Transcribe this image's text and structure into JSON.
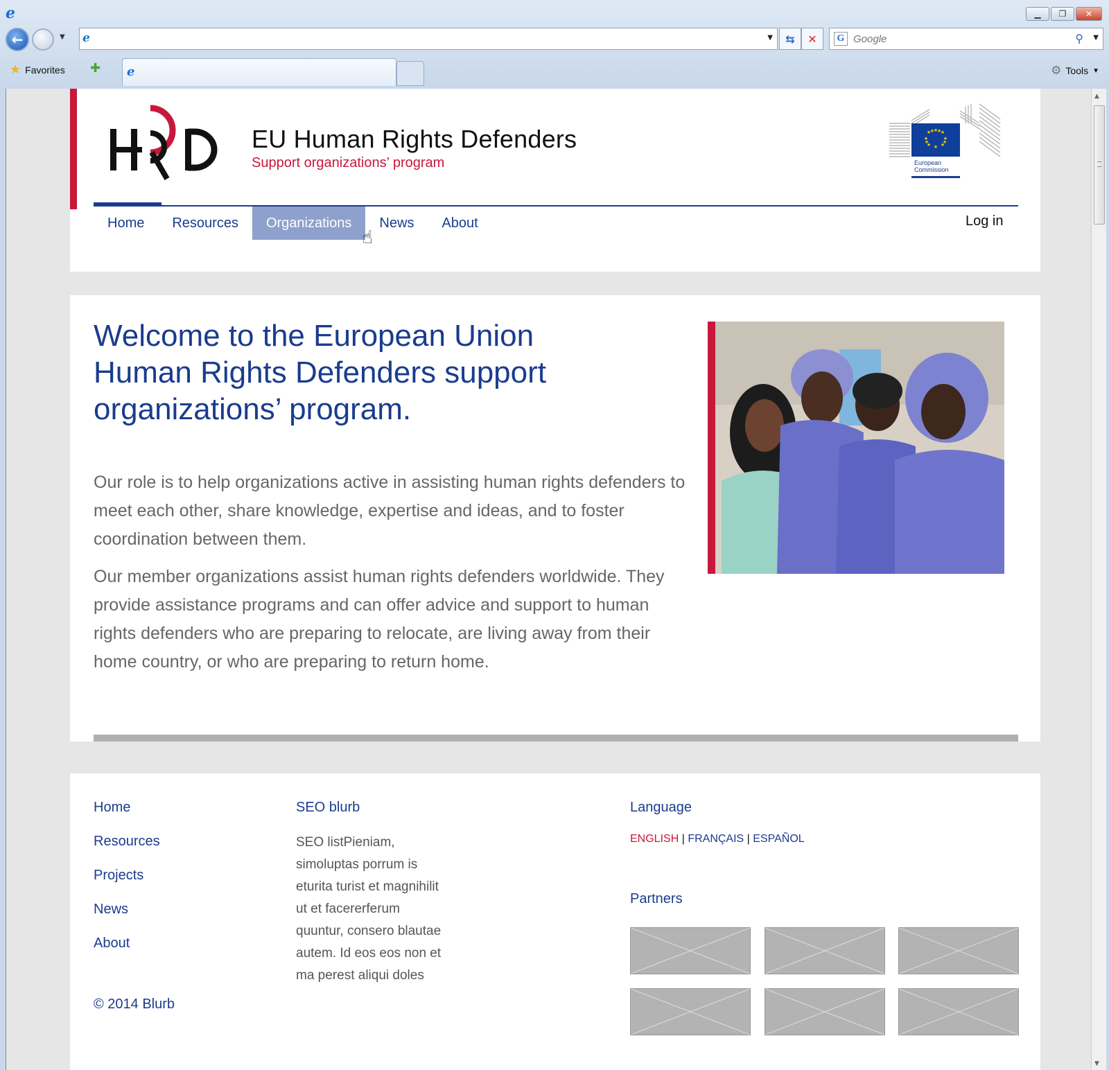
{
  "browser": {
    "search_placeholder": "Google",
    "favorites_label": "Favorites",
    "tools_label": "Tools"
  },
  "site": {
    "title": "EU Human Rights Defenders",
    "subtitle": "Support organizations’ program",
    "ec_label_line1": "European",
    "ec_label_line2": "Commission",
    "login_label": "Log in"
  },
  "nav": {
    "items": [
      {
        "label": "Home"
      },
      {
        "label": "Resources"
      },
      {
        "label": "Organizations"
      },
      {
        "label": "News"
      },
      {
        "label": "About"
      }
    ]
  },
  "main": {
    "welcome_heading": "Welcome to the European Union Human Rights Defenders support organizations’ program.",
    "paragraph_1": "Our role is to help organizations active in assisting human rights defenders to meet each other, share knowledge, expertise and ideas, and to foster coordination between them.",
    "paragraph_2": "Our member organizations assist human rights defenders worldwide. They provide assistance programs and can offer advice and support to human rights defenders who are preparing to relocate, are living away from their home country, or who are preparing to return home."
  },
  "footer": {
    "links": [
      {
        "label": "Home"
      },
      {
        "label": "Resources"
      },
      {
        "label": "Projects"
      },
      {
        "label": "News"
      },
      {
        "label": "About"
      }
    ],
    "copyright": "© 2014 Blurb",
    "seo_title": "SEO blurb",
    "seo_text": "SEO listPieniam, simoluptas porrum is eturita turist et magnihilit ut et facererferum quuntur, consero blautae autem. Id eos eos non et ma perest aliqui doles",
    "language_title": "Language",
    "languages": {
      "english": "ENGLISH",
      "french": "FRANÇAIS",
      "spanish": "ESPAÑOL",
      "separator": "|"
    },
    "partners_title": "Partners"
  },
  "colors": {
    "brand_blue": "#1a3c8e",
    "brand_red": "#c8183c",
    "nav_hover": "#8ea1cc"
  }
}
